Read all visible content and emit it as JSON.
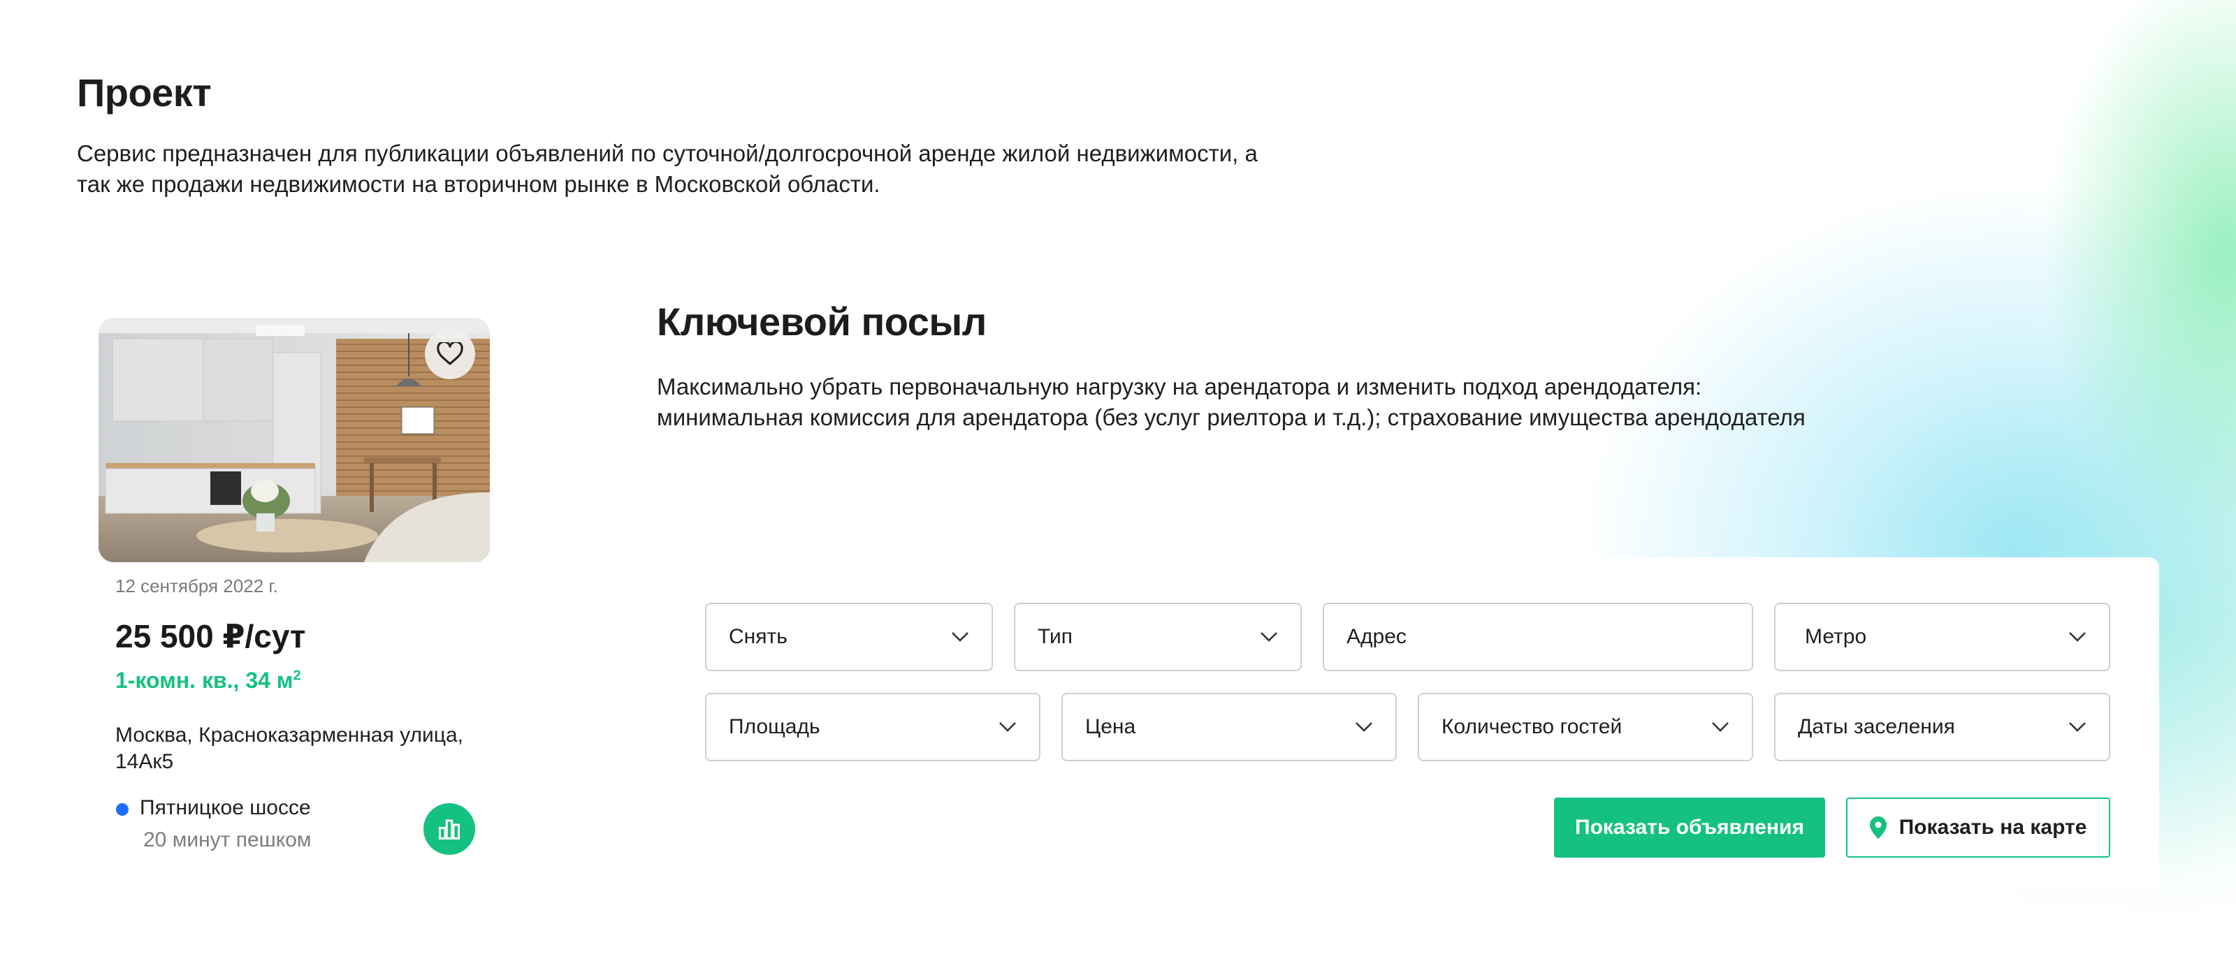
{
  "project": {
    "title": "Проект",
    "description": "Сервис предназначен для публикации объявлений по суточной/долгосрочной аренде жилой недвижимости, а так же продажи недвижимости на вторичном рынке в Московской области."
  },
  "key_message": {
    "title": "Ключевой посыл",
    "description": "Максимально убрать первоначальную нагрузку на арендатора и изменить подход арендодателя: минимальная комиссия для арендатора (без услуг риелтора и т.д.); страхование имущества арендодателя"
  },
  "listing": {
    "date": "12 сентября 2022 г.",
    "price": "25 500 ₽/сут",
    "type": "1-комн. кв., 34 м",
    "type_superscript": "2",
    "address": "Москва, Красноказарменная улица, 14Ак5",
    "metro": {
      "name": "Пятницкое шоссе",
      "walk": "20 минут пешком",
      "line_color": "#1e6dff"
    },
    "icons": {
      "favorite": "heart-icon",
      "stats": "bar-chart-icon"
    }
  },
  "search": {
    "fields": {
      "deal": "Снять",
      "type": "Тип",
      "address": "Адрес",
      "metro": "Метро",
      "area": "Площадь",
      "price": "Цена",
      "guests": "Количество гостей",
      "dates": "Даты заселения"
    },
    "show_listings": "Показать объявления",
    "show_on_map": "Показать на карте"
  },
  "colors": {
    "accent": "#15c181",
    "text": "#1f1f1f",
    "muted": "#7a7a7a"
  }
}
